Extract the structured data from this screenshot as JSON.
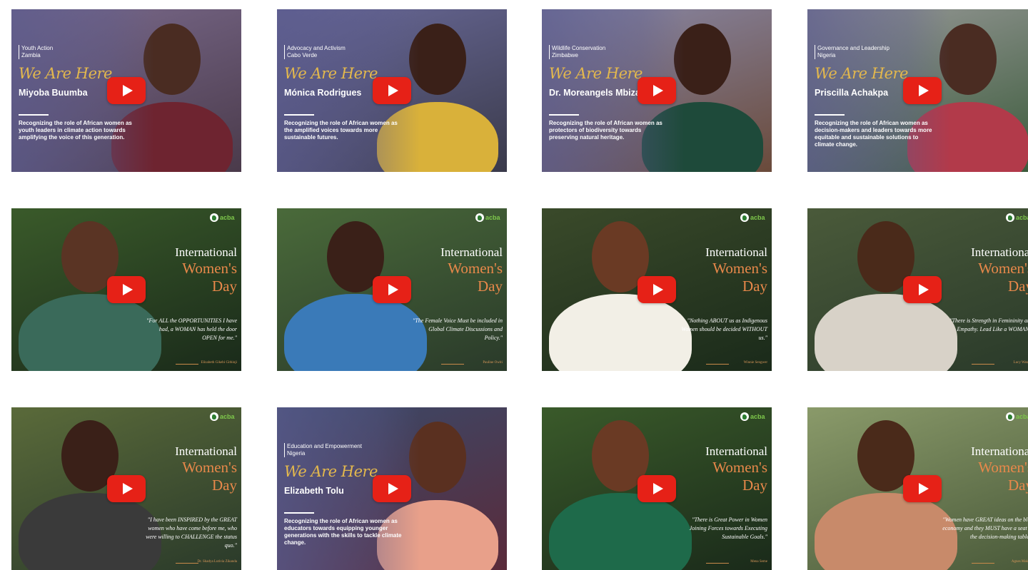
{
  "videos": [
    {
      "style": "wah",
      "bg": [
        "#7a6a8c",
        "#4a3a4a"
      ],
      "skin": "#4a2c22",
      "cloth": "#6e2430",
      "tag_line1": "Youth Action",
      "tag_line2": "Zambia",
      "tagline": "We Are Here",
      "name": "Miyoba Buumba",
      "desc": "Recognizing the role of African women as youth leaders in climate action towards amplifying the voice of this generation.",
      "play_icon": "play-icon"
    },
    {
      "style": "wah",
      "bg": [
        "#6a6a9a",
        "#3a3a4a"
      ],
      "skin": "#3a2018",
      "cloth": "#d9b13a",
      "tag_line1": "Advocacy and Activism",
      "tag_line2": "Cabo Verde",
      "tagline": "We Are Here",
      "name": "Mónica Rodrigues",
      "desc": "Recognizing the role of African women as the amplified voices towards more sustainable futures.",
      "play_icon": "play-icon"
    },
    {
      "style": "wah",
      "bg": [
        "#8a8aaa",
        "#6a4a3a"
      ],
      "skin": "#3a2018",
      "cloth": "#1e4a3a",
      "tag_line1": "Wildlife Conservation",
      "tag_line2": "Zimbabwe",
      "tagline": "We Are Here",
      "name": "Dr. Moreangels Mbizah",
      "desc": "Recognizing the role of African women as protectors of biodiversity towards preserving natural heritage.",
      "play_icon": "play-icon"
    },
    {
      "style": "wah",
      "bg": [
        "#9a9a9a",
        "#3a5a3a"
      ],
      "skin": "#4a2c22",
      "cloth": "#b23a4a",
      "tag_line1": "Governance and Leadership",
      "tag_line2": "Nigeria",
      "tagline": "We Are Here",
      "name": "Priscilla Achakpa",
      "desc": "Recognizing the role of African women as decision-makers and leaders towards more equitable and sustainable solutions to climate change.",
      "play_icon": "play-icon"
    },
    {
      "style": "iwd",
      "bg": [
        "#3a5a2a",
        "#1a2a1a"
      ],
      "skin": "#5a3424",
      "cloth": "#3a6a5a",
      "logo": "acba",
      "iwd1": "International",
      "iwd2": "Women's",
      "iwd3": "Day",
      "quote": "\"For ALL the OPPORTUNITIES I have had, a WOMAN has held the door OPEN for me.\"",
      "author": "Elizabeth Gikebi Githinji",
      "play_icon": "play-icon"
    },
    {
      "style": "iwd",
      "bg": [
        "#4a6a3a",
        "#2a3a2a"
      ],
      "skin": "#3a2018",
      "cloth": "#3a7ab8",
      "logo": "acba",
      "iwd1": "International",
      "iwd2": "Women's",
      "iwd3": "Day",
      "quote": "\"The Female Voice Must be included in Global Climate Discussions and Policy.\"",
      "author": "Pauline Owiti",
      "play_icon": "play-icon"
    },
    {
      "style": "iwd",
      "bg": [
        "#3a4a2a",
        "#1a2a1a"
      ],
      "skin": "#6a3a24",
      "cloth": "#f2efe6",
      "logo": "acba",
      "iwd1": "International",
      "iwd2": "Women's",
      "iwd3": "Day",
      "quote": "\"Nothing ABOUT us as Indigenous Women should be decided WITHOUT us.\"",
      "author": "Winnie Sengwer",
      "play_icon": "play-icon"
    },
    {
      "style": "iwd",
      "bg": [
        "#4a5a3a",
        "#2a3a2a"
      ],
      "skin": "#4a2a1a",
      "cloth": "#d8d2c8",
      "logo": "acba",
      "iwd1": "International",
      "iwd2": "Women's",
      "iwd3": "Day",
      "quote": "\"There is Strength in Femininity and Empathy. Lead Like a WOMAN.\"",
      "author": "Lucy Wanjiru",
      "play_icon": "play-icon"
    },
    {
      "style": "iwd",
      "bg": [
        "#5a6a3a",
        "#2a3a2a"
      ],
      "skin": "#3a2018",
      "cloth": "#3a3a3a",
      "logo": "acba",
      "iwd1": "International",
      "iwd2": "Women's",
      "iwd3": "Day",
      "quote": "\"I have been INSPIRED by the GREAT women who have come before me, who were willing to CHALLENGE the status quo.\"",
      "author": "Dr. Shadya Lutivia Zikanda",
      "play_icon": "play-icon"
    },
    {
      "style": "wah",
      "bg": [
        "#3a4a6a",
        "#5a2a3a"
      ],
      "skin": "#5a3020",
      "cloth": "#e8a08a",
      "tag_line1": "Education and Empowerment",
      "tag_line2": "Nigeria",
      "tagline": "We Are Here",
      "name": "Elizabeth Tolu",
      "desc": "Recognizing the role of African women as educators towards equipping younger generations with the skills to tackle climate change.",
      "play_icon": "play-icon"
    },
    {
      "style": "iwd",
      "bg": [
        "#3a5a2a",
        "#1a2a1a"
      ],
      "skin": "#6a3a24",
      "cloth": "#1e6a4a",
      "logo": "acba",
      "iwd1": "International",
      "iwd2": "Women's",
      "iwd3": "Day",
      "quote": "\"There is Great Power in Women Joining Forces towards Executing Sustainable Goals.\"",
      "author": "Mena Seme",
      "play_icon": "play-icon"
    },
    {
      "style": "iwd",
      "bg": [
        "#8a9a6a",
        "#4a5a3a"
      ],
      "skin": "#4a2a1a",
      "cloth": "#c88a6a",
      "logo": "acba",
      "iwd1": "International",
      "iwd2": "Women's",
      "iwd3": "Day",
      "quote": "\"Women have GREAT ideas on the blue economy and they MUST have a seat at the decision-making table.\"",
      "author": "Agnes Makena",
      "play_icon": "play-icon"
    }
  ]
}
